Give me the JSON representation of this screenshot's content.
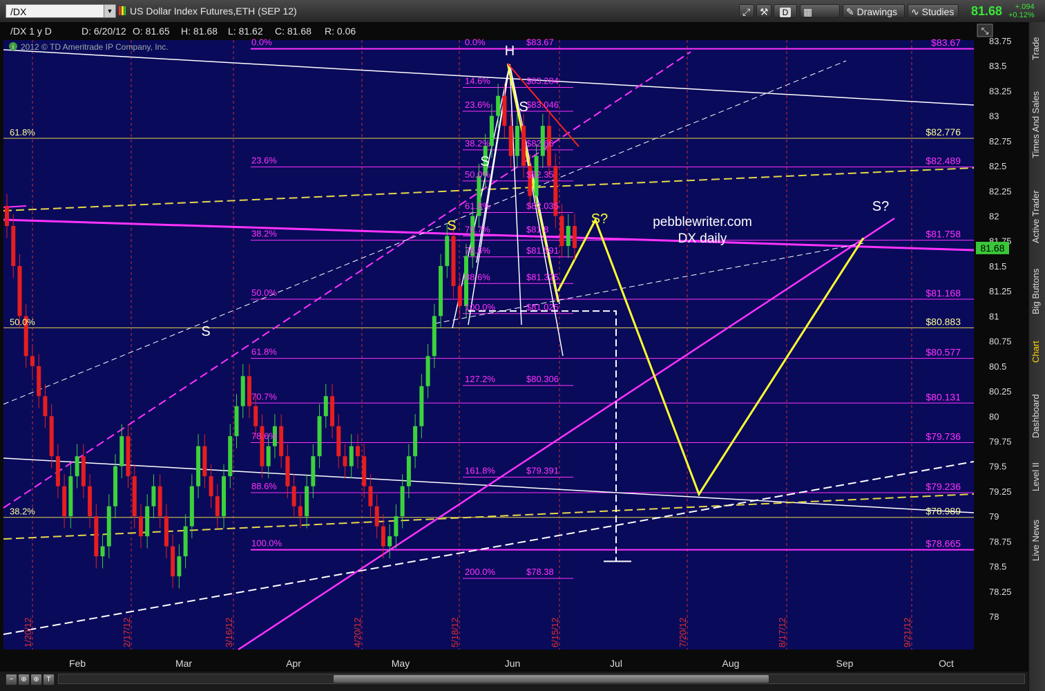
{
  "app": {
    "symbol": "/DX",
    "description": "US Dollar Index Futures,ETH (SEP 12)",
    "buttons": {
      "d": "D",
      "style": "Style",
      "drawings": "Drawings",
      "studies": "Studies"
    },
    "last_price": "81.68",
    "change": "+.094",
    "change_pct": "+0.12%",
    "sidebar_tabs": [
      "Trade",
      "Times And Sales",
      "Active Trader",
      "Big Buttons",
      "Chart",
      "Dashboard",
      "Level II",
      "Live News"
    ],
    "active_tab": "Chart"
  },
  "chart_data": {
    "type": "candlestick",
    "header": {
      "title": "/DX 1 y D",
      "d": "D: 6/20/12",
      "o": "O: 81.65",
      "h": "H: 81.68",
      "l": "L: 81.62",
      "c": "C: 81.68",
      "r": "R: 0.06"
    },
    "copyright": "2012 © TD Ameritrade IP Company, Inc.",
    "annotation": "pebblewriter.com\nDX daily",
    "price_label": "81.68",
    "ylim": [
      77.9,
      83.9
    ],
    "colors": {
      "background": "#0a0a5a",
      "up": "#3cd23c",
      "down": "#e61e1e",
      "fib": "#ff33ff",
      "yellow": "#ffff33",
      "white": "#ffffff",
      "label": "#ffff99"
    },
    "y_ticks": [
      "83.75",
      "83.5",
      "83.25",
      "83",
      "82.75",
      "82.5",
      "82.25",
      "82",
      "81.75",
      "81.5",
      "81.25",
      "81",
      "80.75",
      "80.5",
      "80.25",
      "80",
      "79.75",
      "79.5",
      "79.25",
      "79",
      "78.75",
      "78.5",
      "78.25",
      "78"
    ],
    "x_months": [
      "Feb",
      "Mar",
      "Apr",
      "May",
      "Jun",
      "Jul",
      "Aug",
      "Sep",
      "Oct"
    ],
    "x_dates": [
      "1/20/12",
      "2/17/12",
      "3/16/12",
      "4/20/12",
      "5/18/12",
      "6/15/12",
      "7/20/12",
      "8/17/12",
      "9/21/12"
    ],
    "left_fib": [
      {
        "label": "61.8%",
        "price": 82.776
      },
      {
        "label": "50.0%",
        "price": 80.883
      },
      {
        "label": "38.2%",
        "price": 78.989
      }
    ],
    "mid_fib": [
      {
        "label": "0.0%",
        "price": 83.67
      },
      {
        "label": "23.6%",
        "price": 82.489
      },
      {
        "label": "38.2%",
        "price": 81.758
      },
      {
        "label": "50.0%",
        "price": 81.168
      },
      {
        "label": "61.8%",
        "price": 80.577
      },
      {
        "label": "70.7%",
        "price": 80.131
      },
      {
        "label": "78.6%",
        "price": 79.736
      },
      {
        "label": "88.6%",
        "price": 79.236
      },
      {
        "label": "100.0%",
        "price": 78.665
      }
    ],
    "right_labels": [
      "$83.67",
      "$82.776",
      "$82.489",
      "$81.758",
      "$81.168",
      "$80.883",
      "$80.577",
      "$80.131",
      "$79.736",
      "$79.236",
      "$78.989",
      "$78.665"
    ],
    "inner_fib": [
      {
        "label": "0.0%",
        "value": "$83.67",
        "price": 83.67
      },
      {
        "label": "14.6%",
        "value": "$83.284",
        "price": 83.284
      },
      {
        "label": "23.6%",
        "value": "$83.046",
        "price": 83.046
      },
      {
        "label": "38.2%",
        "value": "$82.66",
        "price": 82.66
      },
      {
        "label": "50.0%",
        "value": "$82.35",
        "price": 82.35
      },
      {
        "label": "61.8%",
        "value": "$82.035",
        "price": 82.035
      },
      {
        "label": "70.7%",
        "value": "$81.8",
        "price": 81.8
      },
      {
        "label": "78.6%",
        "value": "$81.591",
        "price": 81.591
      },
      {
        "label": "88.6%",
        "value": "$81.325",
        "price": 81.325
      },
      {
        "label": "100.0%",
        "value": "$81.025",
        "price": 81.025
      },
      {
        "label": "127.2%",
        "value": "$80.306",
        "price": 80.306
      },
      {
        "label": "161.8%",
        "value": "$79.391",
        "price": 79.391
      },
      {
        "label": "200.0%",
        "value": "$78.38",
        "price": 78.38
      }
    ],
    "hs_labels": {
      "head": "H",
      "shoulder": "S",
      "question": "S?"
    },
    "candles_close": [
      81.9,
      81.5,
      81.0,
      80.6,
      80.5,
      80.2,
      80.0,
      79.6,
      79.3,
      79.0,
      79.4,
      79.6,
      79.3,
      79.0,
      78.6,
      78.7,
      79.1,
      79.5,
      79.8,
      79.4,
      79.0,
      78.8,
      79.1,
      79.3,
      79.0,
      78.7,
      78.4,
      78.6,
      78.9,
      79.3,
      79.7,
      79.4,
      79.2,
      79.0,
      79.4,
      79.8,
      80.1,
      80.4,
      80.1,
      79.9,
      79.5,
      79.7,
      79.9,
      79.6,
      79.3,
      79.1,
      79.0,
      79.3,
      79.6,
      80.0,
      80.2,
      79.9,
      79.6,
      79.5,
      79.7,
      79.6,
      79.3,
      79.1,
      78.9,
      78.7,
      78.8,
      79.0,
      79.3,
      79.6,
      79.9,
      80.3,
      80.6,
      81.0,
      81.5,
      81.8,
      81.3,
      81.1,
      81.6,
      82.0,
      82.4,
      82.7,
      83.0,
      83.2,
      82.9,
      82.6,
      82.9,
      82.5,
      82.2,
      82.6,
      82.9,
      82.5,
      82.0,
      81.7,
      81.9,
      81.68
    ],
    "yellow_projection": [
      81.25,
      81.96,
      79.22,
      81.78
    ],
    "white_bracket_top": 81.05,
    "white_bracket_bottom": 78.55
  }
}
